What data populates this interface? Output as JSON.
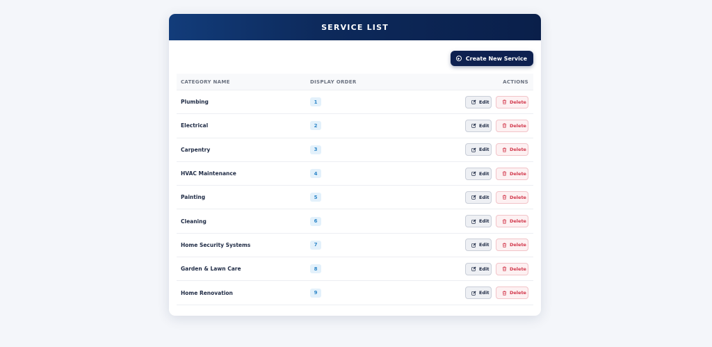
{
  "card": {
    "title": "SERVICE LIST",
    "create_label": "Create New Service"
  },
  "table": {
    "headers": {
      "name": "CATEGORY NAME",
      "order": "DISPLAY ORDER",
      "actions": "ACTIONS"
    },
    "edit_label": "Edit",
    "delete_label": "Delete",
    "rows": [
      {
        "name": "Plumbing",
        "order": "1"
      },
      {
        "name": "Electrical",
        "order": "2"
      },
      {
        "name": "Carpentry",
        "order": "3"
      },
      {
        "name": "HVAC Maintenance",
        "order": "4"
      },
      {
        "name": "Painting",
        "order": "5"
      },
      {
        "name": "Cleaning",
        "order": "6"
      },
      {
        "name": "Home Security Systems",
        "order": "7"
      },
      {
        "name": "Garden & Lawn Care",
        "order": "8"
      },
      {
        "name": "Home Renovation",
        "order": "9"
      }
    ]
  },
  "colors": {
    "header_start": "#123c7a",
    "header_end": "#0a1f4a",
    "primary_button": "#0e2150",
    "badge_bg": "#e3f1fb",
    "badge_text": "#2e86c8",
    "delete_text": "#d2384c"
  },
  "icons": {
    "create": "plus-circle-icon",
    "edit": "pencil-square-icon",
    "delete": "trash-icon"
  }
}
